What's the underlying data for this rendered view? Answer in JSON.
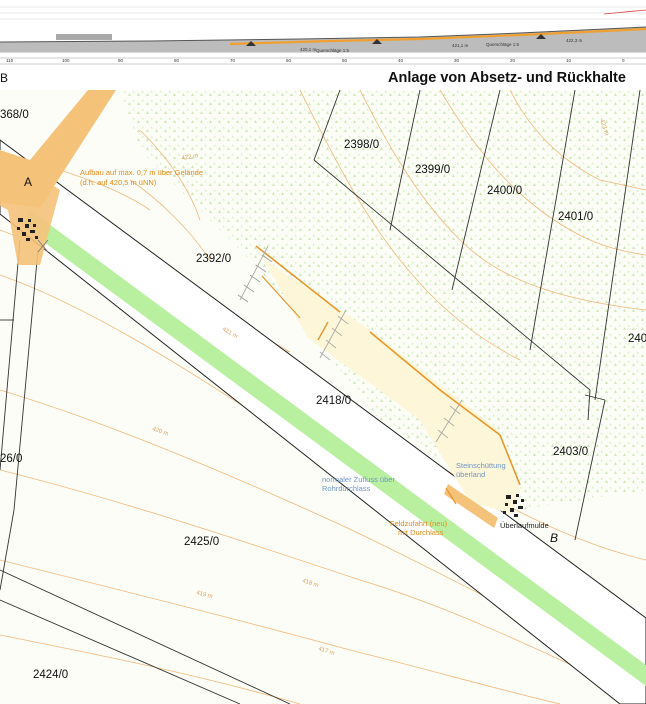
{
  "header": {
    "title": "Anlage von Absetz- und Rückhalte",
    "left_mark": "B"
  },
  "profile": {
    "labels": [
      "Querschläge 1:5",
      "Querschläge 1:5",
      "Querschläge 1:5"
    ],
    "levels": [
      "420,1 m",
      "421,1 m",
      "422,3 m"
    ],
    "station_ticks": [
      "110",
      "100",
      "90",
      "80",
      "70",
      "60",
      "50",
      "40",
      "30",
      "20",
      "10",
      "0"
    ]
  },
  "map": {
    "parcels": [
      {
        "id": "p1",
        "label": "368/0"
      },
      {
        "id": "p2",
        "label": "2398/0"
      },
      {
        "id": "p3",
        "label": "2399/0"
      },
      {
        "id": "p4",
        "label": "2400/0"
      },
      {
        "id": "p5",
        "label": "2401/0"
      },
      {
        "id": "p6",
        "label": "2392/0"
      },
      {
        "id": "p7",
        "label": "240"
      },
      {
        "id": "p8",
        "label": "2418/0"
      },
      {
        "id": "p9",
        "label": "2403/0"
      },
      {
        "id": "p10",
        "label": "26/0"
      },
      {
        "id": "p11",
        "label": "2425/0"
      },
      {
        "id": "p12",
        "label": "2424/0"
      }
    ],
    "section_a": "A",
    "section_b": "B",
    "notes": {
      "aufbau_line1": "Aufbau auf max. 0,7 m über Gelände",
      "aufbau_line2": "(d.h. auf 420,5 m üNN)",
      "zufluss_line1": "normaler Zufluss über",
      "zufluss_line2": "Rohrdurchlass",
      "feldzufahrt_line1": "Feldzufahrt (neu)",
      "feldzufahrt_line2": "mit Durchlass",
      "steinschuettung_line1": "Steinschüttung",
      "steinschuettung_line2": "überland",
      "ueberlaufmulde": "Überlaufmulde"
    },
    "contour_labels": [
      "421 m",
      "420 m",
      "422 m",
      "419 m",
      "418 m",
      "417 m",
      "423 m"
    ],
    "colors": {
      "road_fill": "#f5c27a",
      "ditch_green": "#b9f0a0",
      "basin_fill": "#fdf6d8",
      "contour": "#f0b87a",
      "orange_line": "#e8962a",
      "tree_pattern": "#c8e6b0"
    }
  }
}
